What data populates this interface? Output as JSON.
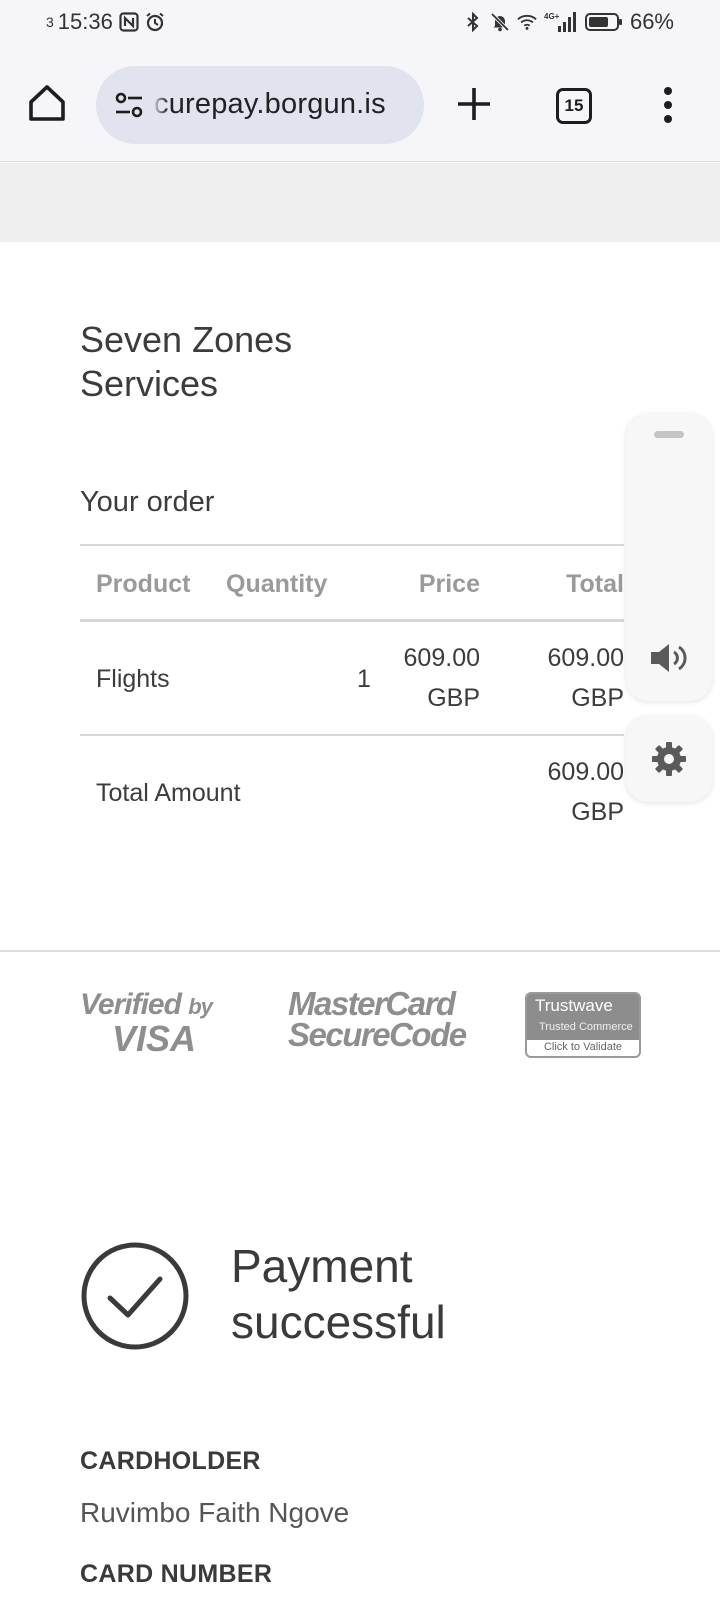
{
  "status_bar": {
    "notification_count": "3",
    "time": "15:36",
    "network_label": "4G+",
    "battery": "66%"
  },
  "browser": {
    "url": "curepay.borgun.is",
    "tab_count": "15"
  },
  "merchant": {
    "name": "Seven Zones Services"
  },
  "order": {
    "title": "Your order",
    "columns": [
      "Product",
      "Quantity",
      "Price",
      "Total"
    ],
    "items": [
      {
        "product": "Flights",
        "quantity": "1",
        "price": "609.00",
        "price_currency": "GBP",
        "total": "609.00",
        "total_currency": "GBP"
      }
    ],
    "total_label": "Total Amount",
    "total_value": "609.00",
    "total_currency": "GBP"
  },
  "security_logos": {
    "visa_line1": "Verified",
    "visa_by": "by",
    "visa_line2": "VISA",
    "mastercard_line1": "MasterCard",
    "mastercard_line2": "SecureCode",
    "trustwave_brand": "Trustwave",
    "trustwave_sub": "Trusted Commerce",
    "trustwave_action": "Click to Validate"
  },
  "payment": {
    "status": "Payment successful",
    "cardholder_label": "CARDHOLDER",
    "cardholder_value": "Ruvimbo Faith Ngove",
    "card_number_label": "CARD NUMBER"
  },
  "icons": {
    "home": "home-icon",
    "site_settings": "tune-icon",
    "new_tab": "plus-icon",
    "tabs": "tab-switcher-icon",
    "menu": "more-vert-icon",
    "volume": "speaker-icon",
    "settings": "gear-icon",
    "success": "check-circle-icon"
  }
}
